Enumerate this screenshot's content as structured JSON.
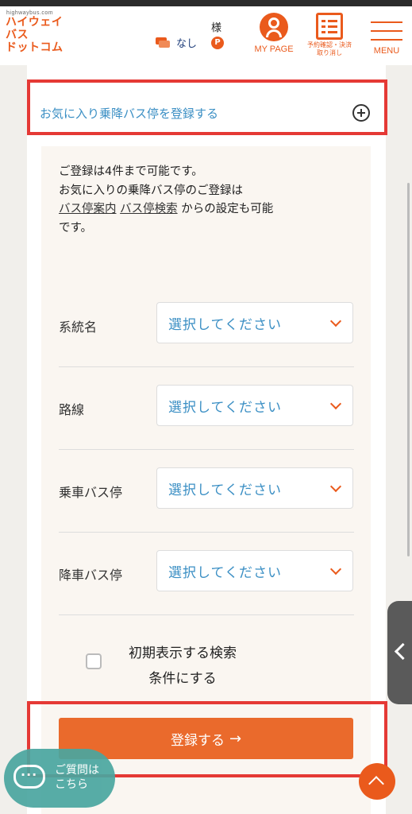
{
  "header": {
    "logo_small": "highwaybus.com",
    "logo_line1": "ハイウェイ",
    "logo_line2": "バス",
    "logo_line3": "ドットコム",
    "sama": "様",
    "nashi": "なし",
    "points_badge": "P",
    "mypage_label": "MY PAGE",
    "reservation_label_line1": "予約確認・決済",
    "reservation_label_line2": "取り消し",
    "menu_label": "MENU"
  },
  "favorites": {
    "title": "お気に入り乗降バス停を登録する"
  },
  "note": {
    "line1": "ご登録は4件まで可能です。",
    "line2": "お気に入りの乗降バス停のご登録は",
    "link1": "バス停案内",
    "link2": "バス停検索",
    "line3_suffix": " からの設定も可能",
    "line4": "です。"
  },
  "form": {
    "rows": [
      {
        "label": "系統名",
        "value": "選択してください"
      },
      {
        "label": "路線",
        "value": "選択してください"
      },
      {
        "label": "乗車バス停",
        "value": "選択してください"
      },
      {
        "label": "降車バス停",
        "value": "選択してください"
      }
    ],
    "checkbox_line1": "初期表示する検索",
    "checkbox_line2": "条件にする",
    "checkbox_checked": false,
    "submit_label": "登録する",
    "submit_arrow": "→"
  },
  "help": {
    "line1": "ご質問は",
    "line2": "こちら"
  },
  "colors": {
    "accent": "#ea5a1c",
    "link_blue": "#3b8fc4",
    "highlight_red": "#e53935",
    "help_teal": "#4aa6a0"
  }
}
